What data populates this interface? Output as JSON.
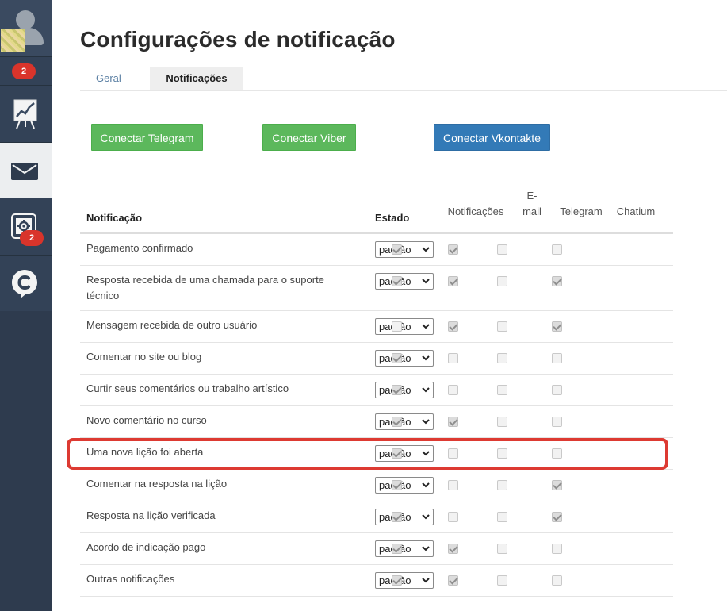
{
  "sidebar": {
    "avatar_icon": "user-avatar-icon",
    "badge_top": "2",
    "badge_settings": "2",
    "items": [
      {
        "icon": "chart-board-icon"
      },
      {
        "icon": "mail-icon",
        "active": true
      },
      {
        "icon": "settings-gear-icon"
      },
      {
        "icon": "chatium-logo-icon"
      }
    ]
  },
  "header": {
    "title": "Configurações de notificação"
  },
  "tabs": [
    {
      "label": "Geral",
      "active": false
    },
    {
      "label": "Notificações",
      "active": true
    }
  ],
  "connect": {
    "telegram": "Conectar Telegram",
    "viber": "Conectar Viber",
    "vkontakte": "Conectar Vkontakte"
  },
  "colors": {
    "green": "#5cb85c",
    "blue": "#337ab7",
    "badge": "#d9342b",
    "highlight": "#dd3a32",
    "sidebar": "#2e3b4e"
  },
  "table": {
    "columns": {
      "notification": "Notificação",
      "status": "Estado",
      "notifications": "Notificações",
      "email_line1": "E-",
      "email_line2": "mail",
      "telegram": "Telegram",
      "chatium": "Chatium"
    },
    "rows": [
      {
        "label": "Pagamento confirmado",
        "status": "padrão",
        "notif": true,
        "email": true,
        "telegram": false,
        "chatium": false
      },
      {
        "label": "Resposta recebida de uma chamada para o suporte técnico",
        "status": "padrão",
        "notif": true,
        "email": true,
        "telegram": false,
        "chatium": true
      },
      {
        "label": "Mensagem recebida de outro usuário",
        "status": "padrão",
        "notif": false,
        "email": true,
        "telegram": false,
        "chatium": true
      },
      {
        "label": "Comentar no site ou blog",
        "status": "padrão",
        "notif": true,
        "email": false,
        "telegram": false,
        "chatium": false
      },
      {
        "label": "Curtir seus comentários ou trabalho artístico",
        "status": "padrão",
        "notif": true,
        "email": false,
        "telegram": false,
        "chatium": false
      },
      {
        "label": "Novo comentário no curso",
        "status": "padrão",
        "notif": true,
        "email": true,
        "telegram": false,
        "chatium": false
      },
      {
        "label": "Uma nova lição foi aberta",
        "status": "padrão",
        "notif": true,
        "email": false,
        "telegram": false,
        "chatium": false,
        "highlighted": true
      },
      {
        "label": "Comentar na resposta na lição",
        "status": "padrão",
        "notif": true,
        "email": false,
        "telegram": false,
        "chatium": true
      },
      {
        "label": "Resposta na lição verificada",
        "status": "padrão",
        "notif": true,
        "email": false,
        "telegram": false,
        "chatium": true
      },
      {
        "label": "Acordo de indicação pago",
        "status": "padrão",
        "notif": true,
        "email": true,
        "telegram": false,
        "chatium": false
      },
      {
        "label": "Outras notificações",
        "status": "padrão",
        "notif": true,
        "email": true,
        "telegram": false,
        "chatium": false
      }
    ]
  }
}
